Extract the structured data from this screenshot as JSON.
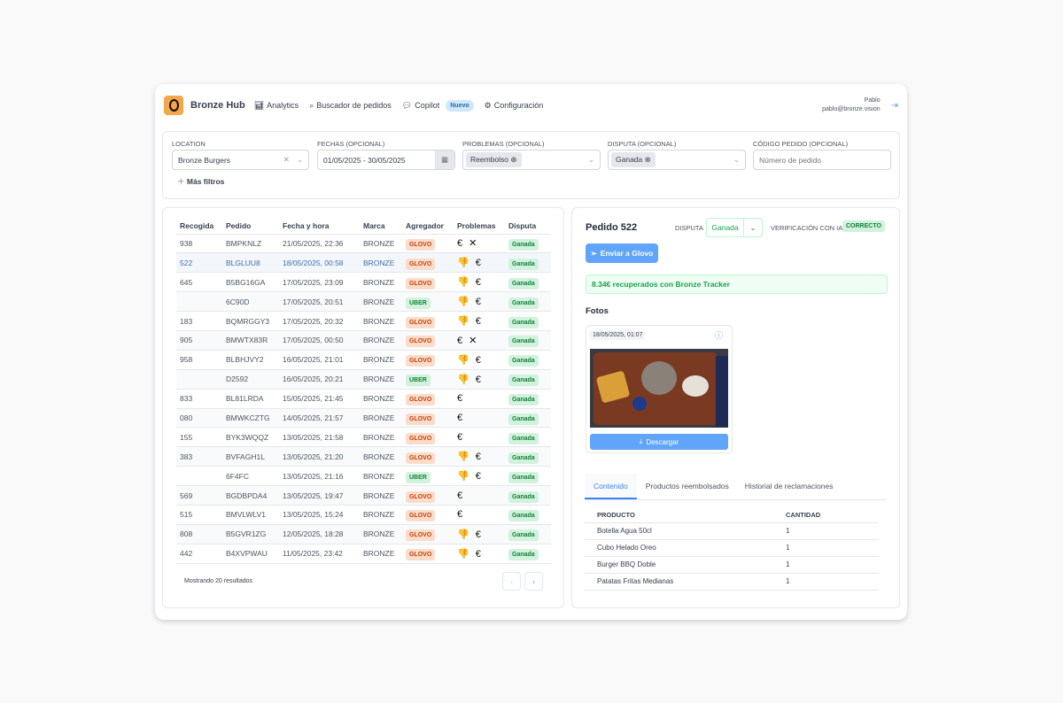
{
  "header": {
    "brand": "Bronze Hub",
    "nav": [
      {
        "label": "Analytics",
        "icon": "bar-chart-icon"
      },
      {
        "label": "Buscador de pedidos",
        "icon": "search-icon"
      },
      {
        "label": "Copilot",
        "icon": "chat-icon",
        "badge": "Nuevo"
      },
      {
        "label": "Configuración",
        "icon": "gear-icon"
      }
    ],
    "user_name": "Pablo",
    "user_email": "pablo@bronze.vision"
  },
  "filters": {
    "location_label": "LOCATION",
    "location_value": "Bronze Burgers",
    "dates_label": "FECHAS (OPCIONAL)",
    "dates_value": "01/05/2025 - 30/05/2025",
    "problems_label": "PROBLEMAS (OPCIONAL)",
    "problems_chip": "Reembolso",
    "dispute_label": "DISPUTA (OPCIONAL)",
    "dispute_chip": "Ganada",
    "code_label": "CÓDIGO PEDIDO (OPCIONAL)",
    "code_placeholder": "Número de pedido",
    "more_filters": "Más filtros"
  },
  "orders": {
    "columns": [
      "Recogida",
      "Pedido",
      "Fecha y hora",
      "Marca",
      "Agregador",
      "Problemas",
      "Disputa"
    ],
    "rows": [
      [
        "938",
        "BMPKNLZ",
        "21/05/2025, 22:36",
        "BRONZE",
        "GLOVO",
        "€ ✕",
        "Ganada"
      ],
      [
        "522",
        "BLGLUU8",
        "18/05/2025, 00:58",
        "BRONZE",
        "GLOVO",
        "👎 €",
        "Ganada"
      ],
      [
        "645",
        "B5BG16GA",
        "17/05/2025, 23:09",
        "BRONZE",
        "GLOVO",
        "👎 €",
        "Ganada"
      ],
      [
        "",
        "6C90D",
        "17/05/2025, 20:51",
        "BRONZE",
        "UBER",
        "👎 €",
        "Ganada"
      ],
      [
        "183",
        "BQMRGGY3",
        "17/05/2025, 20:32",
        "BRONZE",
        "GLOVO",
        "👎 €",
        "Ganada"
      ],
      [
        "905",
        "BMWTX83R",
        "17/05/2025, 00:50",
        "BRONZE",
        "GLOVO",
        "€ ✕",
        "Ganada"
      ],
      [
        "958",
        "BLBHJVY2",
        "16/05/2025, 21:01",
        "BRONZE",
        "GLOVO",
        "👎 €",
        "Ganada"
      ],
      [
        "",
        "D2592",
        "16/05/2025, 20:21",
        "BRONZE",
        "UBER",
        "👎 €",
        "Ganada"
      ],
      [
        "833",
        "BL81LRDA",
        "15/05/2025, 21:45",
        "BRONZE",
        "GLOVO",
        "€",
        "Ganada"
      ],
      [
        "080",
        "BMWKCZTG",
        "14/05/2025, 21:57",
        "BRONZE",
        "GLOVO",
        "€",
        "Ganada"
      ],
      [
        "155",
        "BYK3WQQZ",
        "13/05/2025, 21:58",
        "BRONZE",
        "GLOVO",
        "€",
        "Ganada"
      ],
      [
        "383",
        "BVFAGH1L",
        "13/05/2025, 21:20",
        "BRONZE",
        "GLOVO",
        "👎 €",
        "Ganada"
      ],
      [
        "",
        "6F4FC",
        "13/05/2025, 21:16",
        "BRONZE",
        "UBER",
        "👎 €",
        "Ganada"
      ],
      [
        "569",
        "BGDBPDA4",
        "13/05/2025, 19:47",
        "BRONZE",
        "GLOVO",
        "€",
        "Ganada"
      ],
      [
        "515",
        "BMVLWLV1",
        "13/05/2025, 15:24",
        "BRONZE",
        "GLOVO",
        "€",
        "Ganada"
      ],
      [
        "808",
        "B5GVR1ZG",
        "12/05/2025, 18:28",
        "BRONZE",
        "GLOVO",
        "👎 €",
        "Ganada"
      ],
      [
        "442",
        "B4XVPWAU",
        "11/05/2025, 23:42",
        "BRONZE",
        "GLOVO",
        "👎 €",
        "Ganada"
      ]
    ],
    "selected_index": 1,
    "footer": "Mostrando 20 resultados"
  },
  "detail": {
    "title": "Pedido 522",
    "dispute_label": "DISPUTA",
    "dispute_value": "Ganada",
    "ai_label": "VERIFICACIÓN CON IA",
    "ai_value": "CORRECTO",
    "send_button": "Enviar a Glovo",
    "recovered": "8.34€ recuperados con Bronze Tracker",
    "photos_title": "Fotos",
    "photo_date": "18/05/2025, 01:07",
    "download": "Descargar",
    "tabs": [
      "Contenido",
      "Productos reembolsados",
      "Historial de reclamaciones"
    ],
    "active_tab": 0,
    "products_columns": [
      "PRODUCTO",
      "CANTIDAD"
    ],
    "products": [
      [
        "Botella Agua 50cl",
        "1"
      ],
      [
        "Cubo Helado Oreo",
        "1"
      ],
      [
        "Burger BBQ Doble",
        "1"
      ],
      [
        "Patatas Fritas Medianas",
        "1"
      ]
    ]
  },
  "colors": {
    "accent": "#60a5fa",
    "glovo": "#c2410c",
    "success": "#15803d",
    "logo": "#f5a54a"
  }
}
